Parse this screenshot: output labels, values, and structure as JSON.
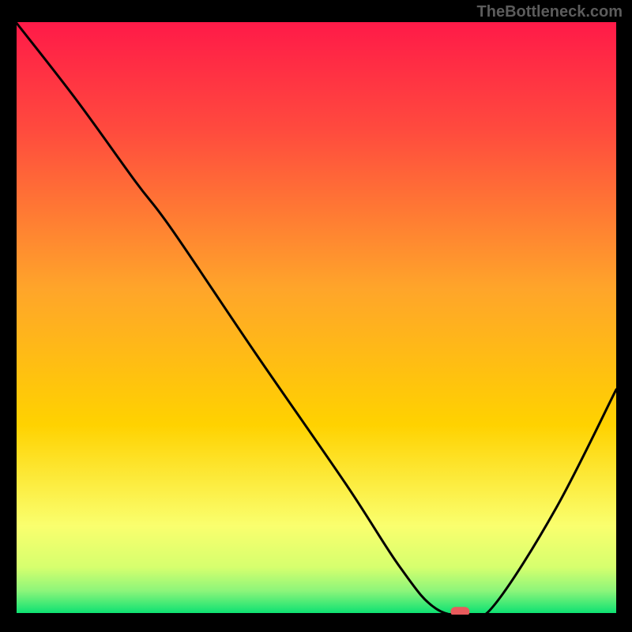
{
  "watermark": "TheBottleneck.com",
  "chart_data": {
    "type": "line",
    "title": "",
    "xlabel": "",
    "ylabel": "",
    "xlim": [
      0,
      100
    ],
    "ylim": [
      0,
      100
    ],
    "background_gradient": {
      "top": "#ff1a48",
      "mid": "#ffd200",
      "lower": "#faff6e",
      "bottom": "#05e072"
    },
    "series": [
      {
        "name": "bottleneck-curve",
        "color": "#000000",
        "x": [
          0,
          10,
          20,
          26,
          40,
          55,
          64,
          70,
          76,
          80,
          90,
          100
        ],
        "y": [
          100,
          87,
          73,
          65,
          44,
          22,
          8,
          1,
          0,
          2,
          18,
          38
        ]
      }
    ],
    "marker": {
      "name": "optimal-point",
      "x": 74,
      "y": 0.5,
      "color": "#e85a5c"
    }
  }
}
